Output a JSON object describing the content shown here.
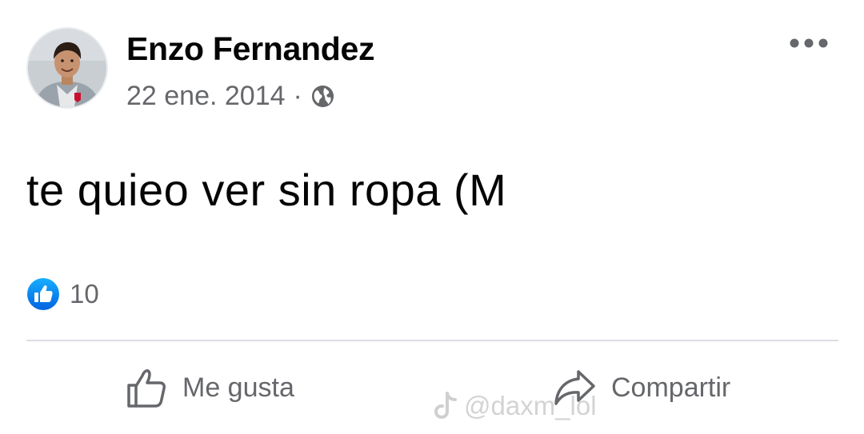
{
  "post": {
    "author": {
      "name": "Enzo Fernandez"
    },
    "meta": {
      "date": "22 ene. 2014",
      "separator": "·",
      "audience_icon": "globe-icon"
    },
    "menu_icon": "more-horizontal-icon",
    "text": "te quieo ver sin ropa (M",
    "reactions": {
      "icon": "like-reaction-icon",
      "count": "10"
    },
    "actions": [
      {
        "label": "Me gusta",
        "icon": "thumbs-up-outline-icon"
      },
      {
        "label": "Compartir",
        "icon": "share-arrow-icon"
      }
    ]
  },
  "watermark": {
    "icon": "tiktok-logo-icon",
    "text": "@daxm_lol"
  },
  "colors": {
    "text_primary": "#050505",
    "text_secondary": "#65676b",
    "like_blue": "#1877f2",
    "divider": "#dcdfe3",
    "background": "#ffffff"
  }
}
